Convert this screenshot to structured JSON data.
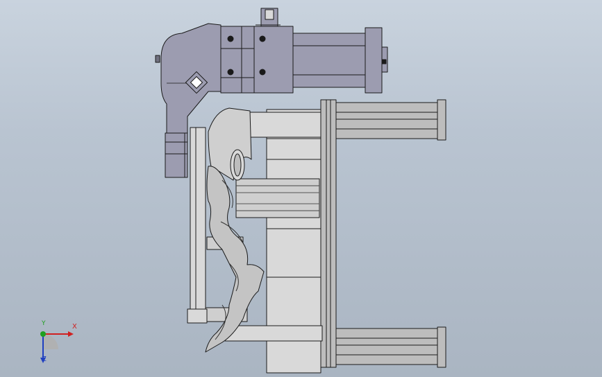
{
  "viewport": {
    "background_top": "#c9d3de",
    "background_bottom": "#aab5c2"
  },
  "model": {
    "part_fill_dark": "#9c9cb0",
    "part_fill_light": "#d9d9d9",
    "part_fill_mid": "#bdbdbd",
    "edge_color": "#1a1a1a"
  },
  "triad": {
    "x_label": "X",
    "y_label": "Y",
    "z_label": "Z",
    "x_color": "#d02020",
    "y_color": "#20a020",
    "z_color": "#2040c0"
  }
}
